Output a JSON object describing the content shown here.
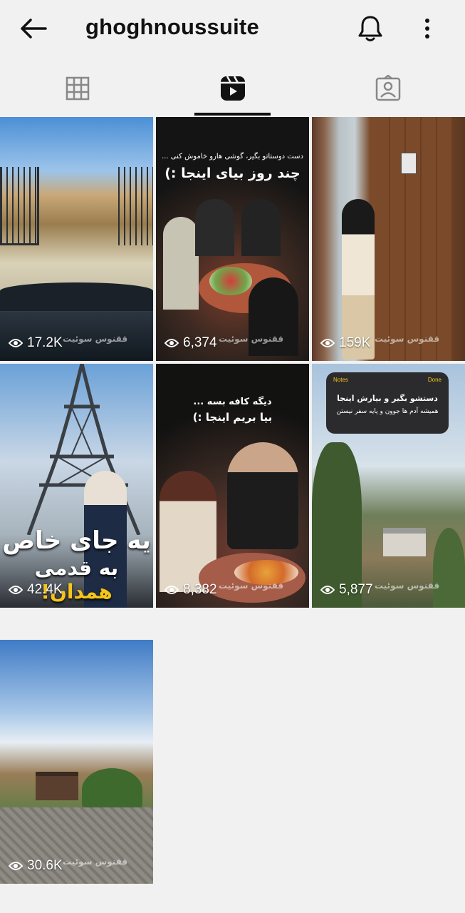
{
  "header": {
    "back_icon": "arrow-left-icon",
    "username": "ghoghnoussuite",
    "notifications_icon": "bell-icon",
    "more_icon": "more-vertical-icon"
  },
  "tabs": [
    {
      "name": "posts",
      "icon": "grid-icon",
      "active": false
    },
    {
      "name": "reels",
      "icon": "reels-icon",
      "active": true
    },
    {
      "name": "tagged",
      "icon": "tagged-person-icon",
      "active": false
    }
  ],
  "reels": [
    {
      "views": "17.2K",
      "watermark": "ققنوس سوئیت"
    },
    {
      "views": "6,374",
      "overlay_small": "دست دوستاتو بگیر، گوشی هارو خاموش کنی ...",
      "overlay_big": "چند روز بیای اینجا :)",
      "watermark": "ققنوس سوئیت"
    },
    {
      "views": "159K",
      "watermark": "ققنوس سوئیت"
    },
    {
      "views": "42.4K",
      "overlay_line1": "یه جای خاص",
      "overlay_line2_pre": "به قدمی",
      "overlay_line2_highlight": "همدان!"
    },
    {
      "views": "8,382",
      "overlay_small": "دیگه کافه بسه ...",
      "overlay_big": "بیا بریم اینجا :)",
      "watermark": "ققنوس سوئیت"
    },
    {
      "views": "5,877",
      "notes_header_left": "Notes",
      "notes_header_right": "Done",
      "notes_title": "دستشو بگیر و بیارش اینجا",
      "notes_body": "همیشه آدم ها جوون و پایه سفر نیستن",
      "watermark": "ققنوس سوئیت"
    },
    {
      "views": "30.6K",
      "watermark": "ققنوس سوئیت"
    }
  ],
  "colors": {
    "background": "#f1f1f1",
    "text": "#111111",
    "highlight_yellow": "#f5c518"
  }
}
